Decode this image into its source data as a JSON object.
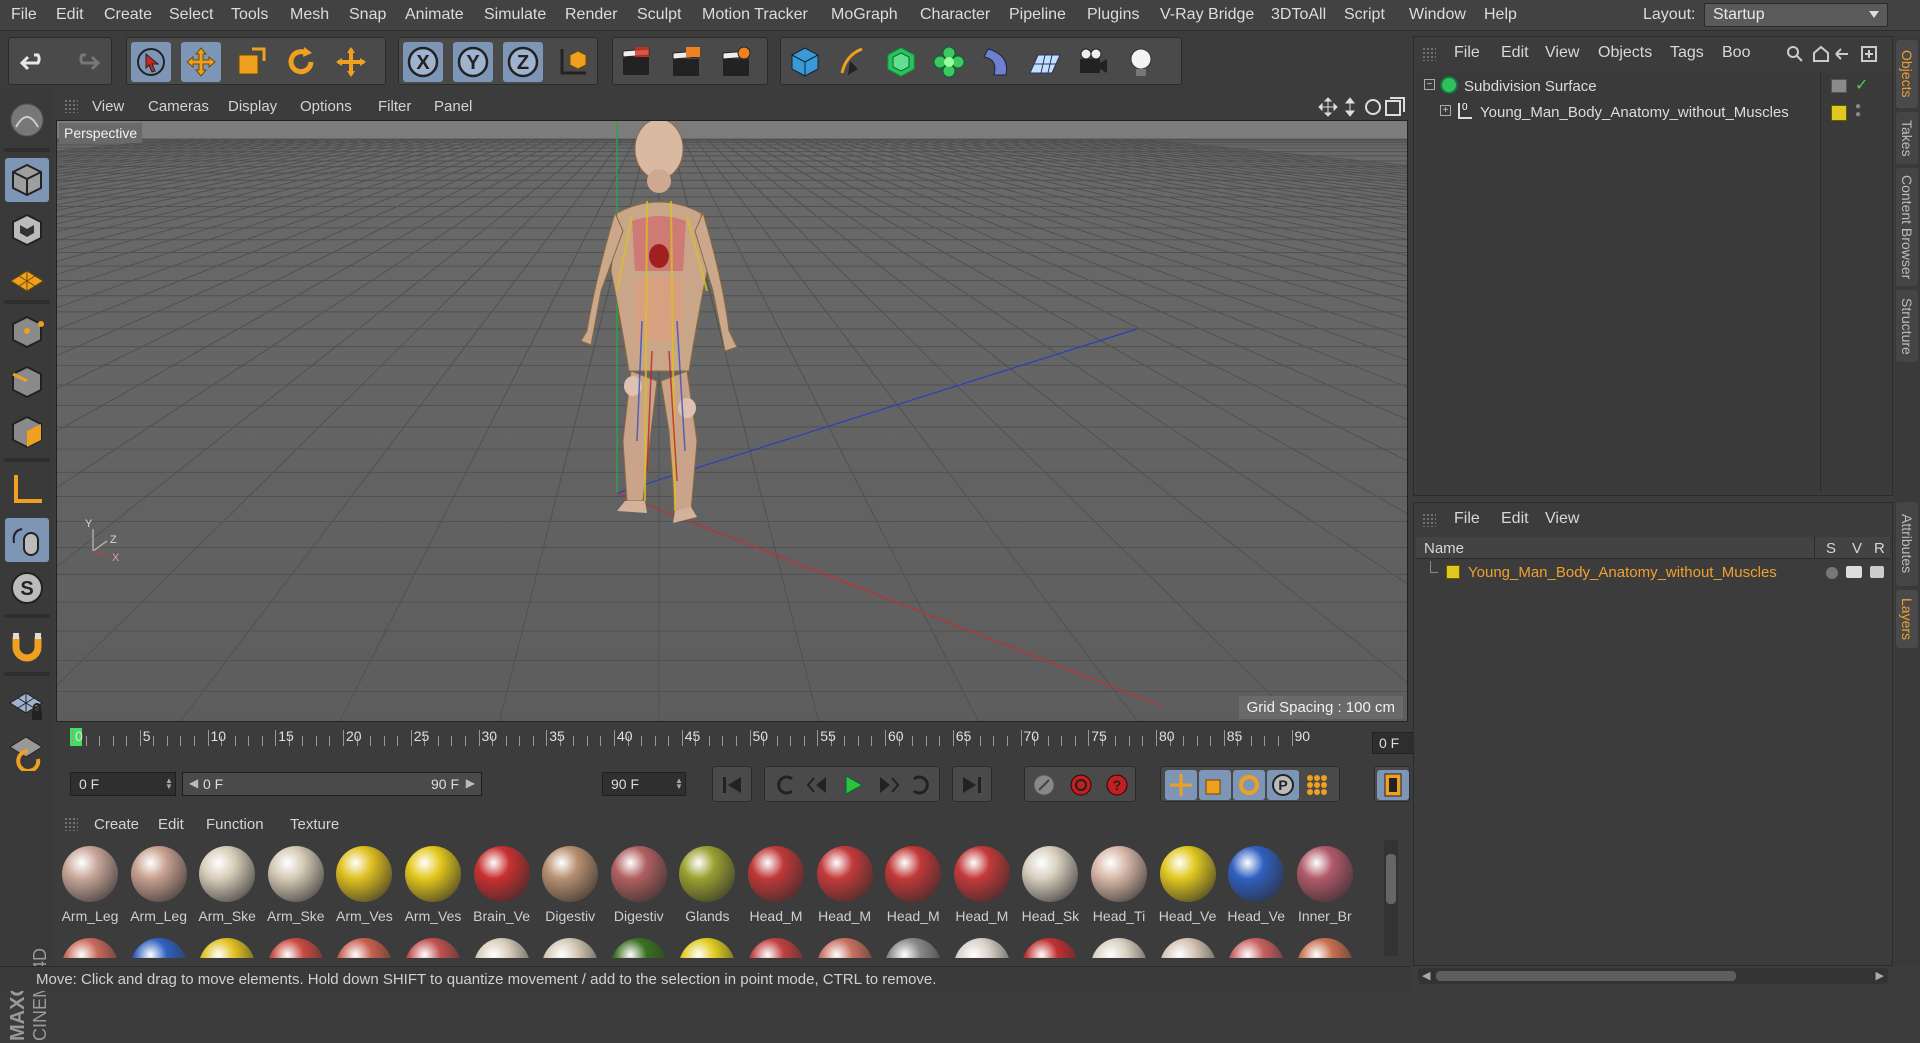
{
  "menubar": {
    "items": [
      "File",
      "Edit",
      "Create",
      "Select",
      "Tools",
      "Mesh",
      "Snap",
      "Animate",
      "Simulate",
      "Render",
      "Sculpt",
      "Motion Tracker",
      "MoGraph",
      "Character",
      "Pipeline",
      "Plugins",
      "V-Ray Bridge",
      "3DToAll",
      "Script",
      "Window",
      "Help"
    ],
    "layout_label": "Layout:",
    "layout_value": "Startup"
  },
  "viewport": {
    "menu": [
      "View",
      "Cameras",
      "Display",
      "Options",
      "Filter",
      "Panel"
    ],
    "label": "Perspective",
    "grid_spacing": "Grid Spacing : 100 cm",
    "axis_labels": {
      "y": "Y",
      "z": "Z",
      "x": "X"
    }
  },
  "timeline": {
    "ticks": [
      "0",
      "5",
      "10",
      "15",
      "20",
      "25",
      "30",
      "35",
      "40",
      "45",
      "50",
      "55",
      "60",
      "65",
      "70",
      "75",
      "80",
      "85",
      "90"
    ],
    "current_frame": "0 F"
  },
  "transport": {
    "start_field": "0 F",
    "range_start": "0 F",
    "range_end": "90 F",
    "end_field": "90 F"
  },
  "materials": {
    "menu": [
      "Create",
      "Edit",
      "Function",
      "Texture"
    ],
    "row1": [
      {
        "name": "Arm_Leg",
        "color": "#c9a79a"
      },
      {
        "name": "Arm_Leg",
        "color": "#c8a08f"
      },
      {
        "name": "Arm_Ske",
        "color": "#d7cdb9"
      },
      {
        "name": "Arm_Ske",
        "color": "#d4cab5"
      },
      {
        "name": "Arm_Ves",
        "color": "#e0c020"
      },
      {
        "name": "Arm_Ves",
        "color": "#e4c81c"
      },
      {
        "name": "Brain_Ve",
        "color": "#c83030"
      },
      {
        "name": "Digestiv",
        "color": "#b89070"
      },
      {
        "name": "Digestiv",
        "color": "#b06060"
      },
      {
        "name": "Glands",
        "color": "#9aa030"
      },
      {
        "name": "Head_M",
        "color": "#c03838"
      },
      {
        "name": "Head_M",
        "color": "#c43a3a"
      },
      {
        "name": "Head_M",
        "color": "#c23838"
      },
      {
        "name": "Head_M",
        "color": "#c33939"
      },
      {
        "name": "Head_Sk",
        "color": "#d8cfbf"
      },
      {
        "name": "Head_Ti",
        "color": "#d8b8a8"
      },
      {
        "name": "Head_Ve",
        "color": "#e0c820"
      },
      {
        "name": "Head_Ve",
        "color": "#3060c0"
      },
      {
        "name": "Inner_Br",
        "color": "#b05a6a"
      }
    ],
    "row2_colors": [
      "#c86a5a",
      "#3060c0",
      "#e0c020",
      "#c84a40",
      "#c86050",
      "#c05050",
      "#d8ccbb",
      "#d4c8b4",
      "#3a7020",
      "#e0cc20",
      "#c04040",
      "#c87060",
      "#888888",
      "#d8d0c8",
      "#c03030",
      "#d8d0c0",
      "#d4c4b4",
      "#c86060",
      "#c87050"
    ]
  },
  "status": "Move: Click and drag to move elements. Hold down SHIFT to quantize movement / add to the selection in point mode, CTRL to remove.",
  "objects_panel": {
    "menu": [
      "File",
      "Edit",
      "View",
      "Objects",
      "Tags",
      "Boo"
    ],
    "rows": [
      {
        "name": "Subdivision Surface"
      },
      {
        "name": "Young_Man_Body_Anatomy_without_Muscles"
      }
    ]
  },
  "attributes_panel": {
    "menu": [
      "File",
      "Edit",
      "View"
    ],
    "header": {
      "name": "Name",
      "s": "S",
      "v": "V",
      "r": "R"
    },
    "layer_name": "Young_Man_Body_Anatomy_without_Muscles",
    "layer_color": "#e0c820"
  },
  "side_tabs": [
    "Objects",
    "Takes",
    "Content Browser",
    "Structure",
    "Attributes",
    "Layers"
  ],
  "colors": {
    "accent": "#7e96b6",
    "highlight": "#f0a030"
  }
}
